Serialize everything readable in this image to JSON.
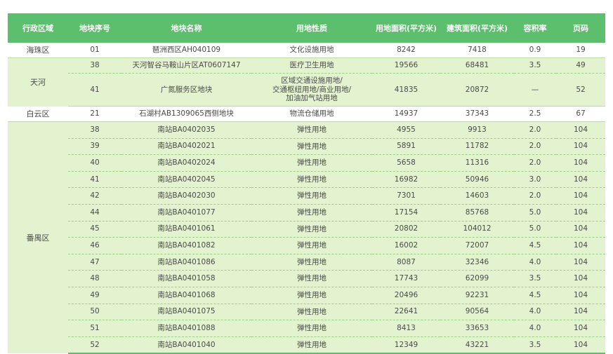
{
  "table": {
    "headers": [
      "行政区域",
      "地块序号",
      "地块名称",
      "用地性质",
      "用地面积(平方米)",
      "建筑面积(平方米)",
      "容积率",
      "页码"
    ],
    "groups": [
      {
        "district": "海珠区",
        "shade": "white",
        "rows": [
          {
            "no": "01",
            "name": "琶洲西区AH040109",
            "nature": [
              "文化设施用地"
            ],
            "land_area": "8242",
            "floor_area": "7418",
            "far": "0.9",
            "page": "19"
          }
        ]
      },
      {
        "district": "天河",
        "shade": "green",
        "rows": [
          {
            "no": "38",
            "name": "天河智谷马鞍山片区AT0607147",
            "nature": [
              "医疗卫生用地"
            ],
            "land_area": "19566",
            "floor_area": "68481",
            "far": "3.5",
            "page": "49"
          },
          {
            "no": "41",
            "name": "广氮服务区地块",
            "nature": [
              "区域交通设施用地/",
              "交通枢纽用地/商业用地/",
              "加油加气站用地"
            ],
            "land_area": "41835",
            "floor_area": "20872",
            "far": "—",
            "page": "52"
          }
        ]
      },
      {
        "district": "白云区",
        "shade": "white",
        "rows": [
          {
            "no": "21",
            "name": "石湖村AB1309065西侧地块",
            "nature": [
              "物流仓储用地"
            ],
            "land_area": "14937",
            "floor_area": "37343",
            "far": "2.5",
            "page": "67"
          }
        ]
      },
      {
        "district": "番禺区",
        "shade": "green",
        "rows": [
          {
            "no": "38",
            "name": "南站BA0402035",
            "nature": [
              "弹性用地"
            ],
            "land_area": "4955",
            "floor_area": "9913",
            "far": "2.0",
            "page": "104"
          },
          {
            "no": "39",
            "name": "南站BA0402021",
            "nature": [
              "弹性用地"
            ],
            "land_area": "5891",
            "floor_area": "11782",
            "far": "2.0",
            "page": "104"
          },
          {
            "no": "40",
            "name": "南站BA0402024",
            "nature": [
              "弹性用地"
            ],
            "land_area": "5658",
            "floor_area": "11316",
            "far": "2.0",
            "page": "104"
          },
          {
            "no": "41",
            "name": "南站BA0402045",
            "nature": [
              "弹性用地"
            ],
            "land_area": "16982",
            "floor_area": "50946",
            "far": "3.0",
            "page": "104"
          },
          {
            "no": "42",
            "name": "南站BA0402030",
            "nature": [
              "弹性用地"
            ],
            "land_area": "7301",
            "floor_area": "14603",
            "far": "2.0",
            "page": "104"
          },
          {
            "no": "44",
            "name": "南站BA0401077",
            "nature": [
              "弹性用地"
            ],
            "land_area": "17154",
            "floor_area": "85768",
            "far": "5.0",
            "page": "104"
          },
          {
            "no": "45",
            "name": "南站BA0401061",
            "nature": [
              "弹性用地"
            ],
            "land_area": "20802",
            "floor_area": "104012",
            "far": "5.0",
            "page": "104"
          },
          {
            "no": "46",
            "name": "南站BA0401082",
            "nature": [
              "弹性用地"
            ],
            "land_area": "16002",
            "floor_area": "72007",
            "far": "4.5",
            "page": "104"
          },
          {
            "no": "47",
            "name": "南站BA0401086",
            "nature": [
              "弹性用地"
            ],
            "land_area": "8087",
            "floor_area": "32346",
            "far": "4.0",
            "page": "104"
          },
          {
            "no": "48",
            "name": "南站BA0401058",
            "nature": [
              "弹性用地"
            ],
            "land_area": "17743",
            "floor_area": "62099",
            "far": "3.5",
            "page": "104"
          },
          {
            "no": "49",
            "name": "南站BA0401068",
            "nature": [
              "弹性用地"
            ],
            "land_area": "20496",
            "floor_area": "92231",
            "far": "4.5",
            "page": "104"
          },
          {
            "no": "50",
            "name": "南站BA0401075",
            "nature": [
              "弹性用地"
            ],
            "land_area": "22641",
            "floor_area": "90564",
            "far": "4.0",
            "page": "104"
          },
          {
            "no": "51",
            "name": "南站BA0401088",
            "nature": [
              "弹性用地"
            ],
            "land_area": "8413",
            "floor_area": "33653",
            "far": "4.0",
            "page": "104"
          },
          {
            "no": "52",
            "name": "南站BA0401040",
            "nature": [
              "弹性用地"
            ],
            "land_area": "12349",
            "floor_area": "43221",
            "far": "3.5",
            "page": "104"
          }
        ]
      }
    ]
  },
  "colors": {
    "header_bg": "#5cbf6e",
    "row_green": "#e3f3cf",
    "row_white": "#ffffff",
    "text": "#4a4a4a"
  }
}
